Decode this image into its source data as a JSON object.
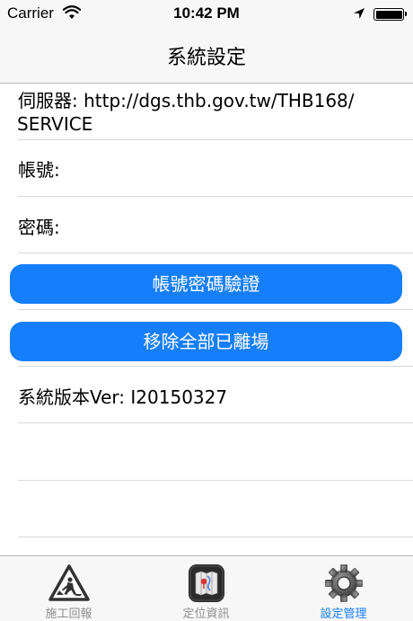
{
  "status": {
    "carrier": "Carrier",
    "time": "10:42 PM"
  },
  "nav": {
    "title": "系統設定"
  },
  "form": {
    "server_label": "伺服器: http://dgs.thb.gov.tw/THB168/",
    "server_label_line2": "SERVICE",
    "account_label": "帳號:",
    "password_label": "密碼:",
    "verify_button": "帳號密碼驗證",
    "remove_button": "移除全部已離場",
    "version_label": "系統版本Ver: I20150327"
  },
  "tabs": [
    {
      "label": "施工回報",
      "icon": "construction-warning-icon"
    },
    {
      "label": "定位資訊",
      "icon": "map-location-icon"
    },
    {
      "label": "設定管理",
      "icon": "gear-icon",
      "active": true
    }
  ],
  "colors": {
    "accent": "#157efb",
    "tab_inactive": "#8e8e8e"
  }
}
